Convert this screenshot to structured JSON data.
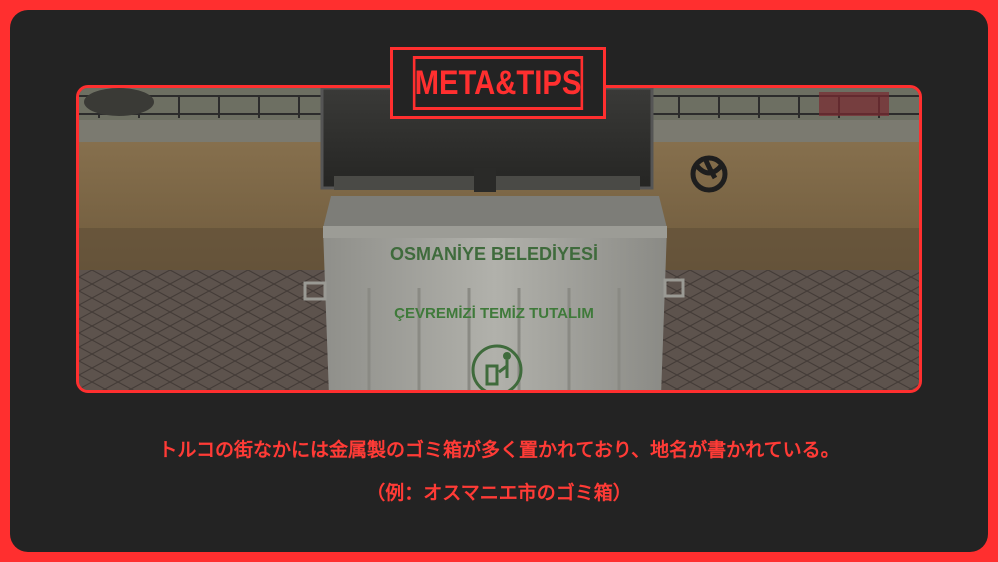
{
  "badge": {
    "text": "META&TIPS"
  },
  "photo": {
    "bin_text_line1": "OSMANİYE BELEDİYESİ",
    "bin_text_line2": "ÇEVREMİZİ TEMİZ TUTALIM"
  },
  "caption": {
    "line1": "トルコの街なかには金属製のゴミ箱が多く置かれており、地名が書かれている。",
    "line2": "（例：オスマニエ市のゴミ箱）"
  },
  "colors": {
    "accent": "#ff2f2f",
    "card_background": "#232323"
  }
}
